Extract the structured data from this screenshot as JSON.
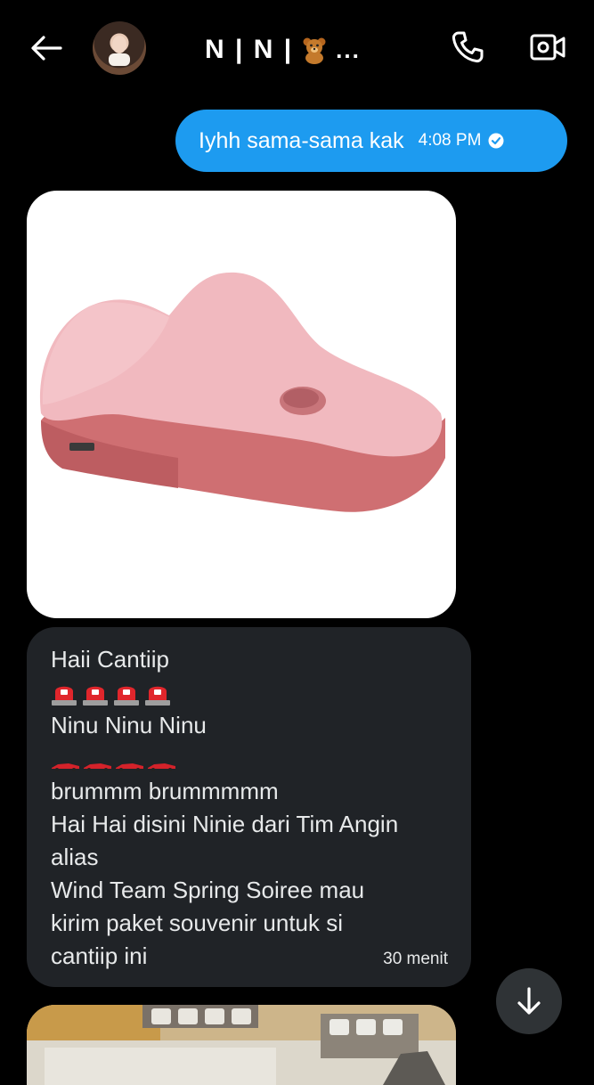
{
  "header": {
    "title": "N | N |",
    "title_suffix": "...",
    "icons": [
      "back-arrow-icon",
      "bear-emoji-icon",
      "phone-icon",
      "video-camera-icon"
    ]
  },
  "messages": {
    "sent": {
      "text": "Iyhh sama-sama kak",
      "time": "4:08 PM",
      "status_icon": "read-check-icon"
    },
    "received_text": {
      "lines": {
        "l1": "Haii Cantiip",
        "l2": "Ninu Ninu Ninu",
        "l3": "brummm brummmmm",
        "l4": "Hai Hai disini Ninie dari Tim Angin",
        "l5": "alias",
        "l6": "Wind Team Spring Soiree mau",
        "l7": "kirim paket souvenir untuk si",
        "l8": "cantiip ini"
      },
      "emojis": [
        "siren-emoji",
        "race-car-emoji"
      ],
      "time": "30 menit"
    }
  },
  "colors": {
    "background": "#000000",
    "sent_bubble": "#1d9bf0",
    "received_bubble": "#202327",
    "text": "#e7e9ea"
  }
}
